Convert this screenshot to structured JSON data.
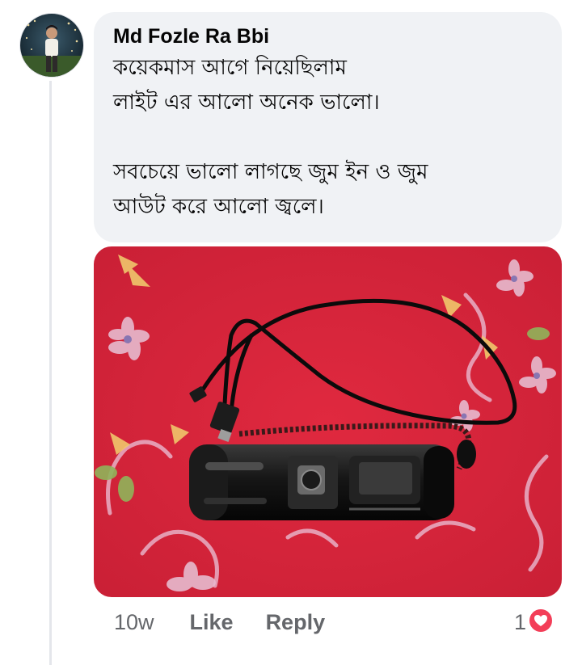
{
  "comment": {
    "author": "Md Fozle Ra Bbi",
    "lines": [
      "কয়েকমাস আগে নিয়েছিলাম",
      "লাইট এর আলো অনেক ভালো।",
      "",
      "সবচেয়ে ভালো লাগছে জুম ইন ও জুম",
      "আউট করে আলো জ্বলে।"
    ],
    "timestamp": "10w",
    "like_label": "Like",
    "reply_label": "Reply",
    "reaction_count": "1",
    "reaction_icon": "heart-icon",
    "reaction_color": "#f33e58"
  },
  "colors": {
    "bubble_bg": "#f0f2f5",
    "meta_text": "#65676b",
    "photo_bg": "#d9263d"
  }
}
